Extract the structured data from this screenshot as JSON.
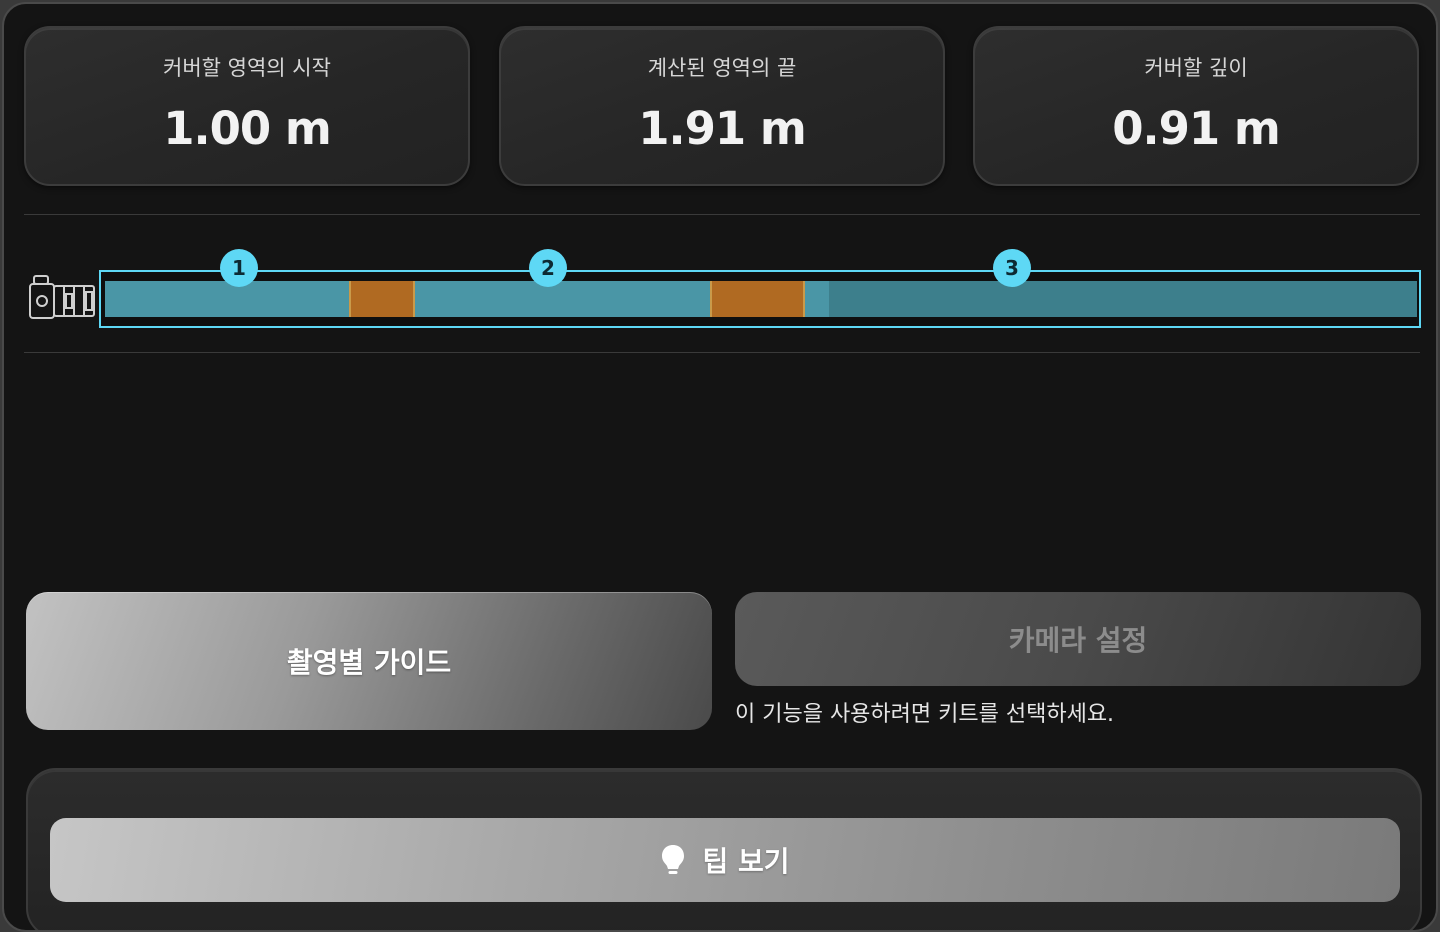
{
  "cards": [
    {
      "label": "커버할 영역의 시작",
      "value": "1.00 m"
    },
    {
      "label": "계산된 영역의 끝",
      "value": "1.91 m"
    },
    {
      "label": "커버할 깊이",
      "value": "0.91 m"
    }
  ],
  "strip": {
    "markers": [
      "1",
      "2",
      "3"
    ],
    "colors": {
      "active": "#4a96a6",
      "inactive": "#3d7f8c",
      "overlap": "#b06a22",
      "border": "#5ed8f5"
    }
  },
  "buttons": {
    "guide_label": "촬영별 가이드",
    "camera_label": "카메라 설정",
    "camera_hint": "이 기능을 사용하려면 키트를 선택하세요.",
    "tip_label": "팁 보기"
  }
}
